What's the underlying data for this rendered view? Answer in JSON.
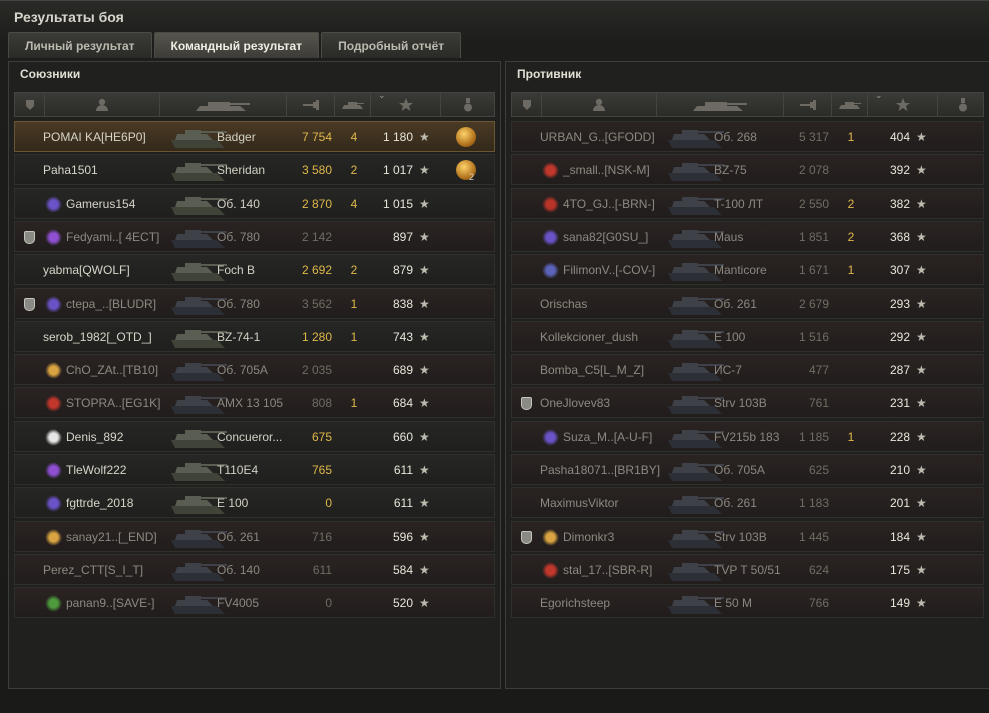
{
  "window_title": "Результаты боя",
  "tabs": [
    "Личный результат",
    "Командный результат",
    "Подробный отчёт"
  ],
  "active_tab": 1,
  "allies_title": "Союзники",
  "enemies_title": "Противник",
  "star_glyph": "★",
  "allies": [
    {
      "player": "POMAI KA[HE6P0]",
      "tank": "Badger",
      "damage": "7 754",
      "kills": "4",
      "xp": "1 180",
      "state": "me",
      "badge": "",
      "medal": "gold"
    },
    {
      "player": "Paha1501",
      "tank": "Sheridan",
      "damage": "3 580",
      "kills": "2",
      "xp": "1 017",
      "state": "alive",
      "badge": "",
      "medal": "gold2",
      "medal_count": "2"
    },
    {
      "player": "Gamerus154",
      "tank": "Об. 140",
      "damage": "2 870",
      "kills": "4",
      "xp": "1 015",
      "state": "alive",
      "badge": "purple",
      "medal": ""
    },
    {
      "player": "Fedyami..[ 4ECT]",
      "tank": "Об. 780",
      "damage": "2 142",
      "kills": "",
      "xp": "897",
      "state": "dead",
      "badge": "violet",
      "premium": true,
      "medal": ""
    },
    {
      "player": "yabma[QWOLF]",
      "tank": "Foch B",
      "damage": "2 692",
      "kills": "2",
      "xp": "879",
      "state": "alive",
      "badge": "",
      "medal": ""
    },
    {
      "player": "ctepa_..[BLUDR]",
      "tank": "Об. 780",
      "damage": "3 562",
      "kills": "1",
      "xp": "838",
      "state": "dead",
      "badge": "purple",
      "premium": true,
      "medal": ""
    },
    {
      "player": "serob_1982[_OTD_]",
      "tank": "BZ-74-1",
      "damage": "1 280",
      "kills": "1",
      "xp": "743",
      "state": "alive",
      "badge": "",
      "medal": ""
    },
    {
      "player": "ChO_ZAt..[TB10]",
      "tank": "Об. 705А",
      "damage": "2 035",
      "kills": "",
      "xp": "689",
      "state": "dead",
      "badge": "gold",
      "medal": ""
    },
    {
      "player": "STOPRA..[EG1K]",
      "tank": "AMX 13 105",
      "damage": "808",
      "kills": "1",
      "xp": "684",
      "state": "dead",
      "badge": "red",
      "medal": ""
    },
    {
      "player": "Denis_892",
      "tank": "Concueror...",
      "damage": "675",
      "kills": "",
      "xp": "660",
      "state": "alive",
      "badge": "white",
      "medal": ""
    },
    {
      "player": "TleWolf222",
      "tank": "T110E4",
      "damage": "765",
      "kills": "",
      "xp": "611",
      "state": "alive",
      "badge": "violet",
      "medal": ""
    },
    {
      "player": "fgttrde_2018",
      "tank": "E 100",
      "damage": "0",
      "kills": "",
      "xp": "611",
      "state": "alive",
      "badge": "purple",
      "medal": ""
    },
    {
      "player": "sanay21..[_END]",
      "tank": "Об. 261",
      "damage": "716",
      "kills": "",
      "xp": "596",
      "state": "dead",
      "badge": "gold",
      "medal": ""
    },
    {
      "player": "Perez_CTT[S_I_T]",
      "tank": "Об. 140",
      "damage": "611",
      "kills": "",
      "xp": "584",
      "state": "dead",
      "badge": "",
      "medal": ""
    },
    {
      "player": "panan9..[SAVE-]",
      "tank": "FV4005",
      "damage": "0",
      "kills": "",
      "xp": "520",
      "state": "dead",
      "badge": "green",
      "medal": ""
    }
  ],
  "enemies": [
    {
      "player": "URBAN_G..[GFODD]",
      "tank": "Об. 268",
      "damage": "5 317",
      "kills": "1",
      "xp": "404",
      "state": "dead",
      "badge": ""
    },
    {
      "player": "_small..[NSK-M]",
      "tank": "BZ-75",
      "damage": "2 078",
      "kills": "",
      "xp": "392",
      "state": "dead",
      "badge": "red"
    },
    {
      "player": "4TO_GJ..[-BRN-]",
      "tank": "T-100 ЛТ",
      "damage": "2 550",
      "kills": "2",
      "xp": "382",
      "state": "dead",
      "badge": "redwhite"
    },
    {
      "player": "sana82[G0SU_]",
      "tank": "Maus",
      "damage": "1 851",
      "kills": "2",
      "xp": "368",
      "state": "dead",
      "badge": "purple"
    },
    {
      "player": "FilimonV..[-COV-]",
      "tank": "Manticore",
      "damage": "1 671",
      "kills": "1",
      "xp": "307",
      "state": "dead",
      "badge": "plane"
    },
    {
      "player": "Orischas",
      "tank": "Об. 261",
      "damage": "2 679",
      "kills": "",
      "xp": "293",
      "state": "dead",
      "badge": ""
    },
    {
      "player": "Kollekcioner_dush",
      "tank": "E 100",
      "damage": "1 516",
      "kills": "",
      "xp": "292",
      "state": "dead",
      "badge": ""
    },
    {
      "player": "Bomba_C5[L_M_Z]",
      "tank": "ИС-7",
      "damage": "477",
      "kills": "",
      "xp": "287",
      "state": "dead",
      "badge": ""
    },
    {
      "player": "OneJlovev83",
      "tank": "Strv 103B",
      "damage": "761",
      "kills": "",
      "xp": "231",
      "state": "dead",
      "badge": "",
      "premium": true
    },
    {
      "player": "Suza_M..[A-U-F]",
      "tank": "FV215b 183",
      "damage": "1 185",
      "kills": "1",
      "xp": "228",
      "state": "dead",
      "badge": "purple"
    },
    {
      "player": "Pasha18071..[BR1BY]",
      "tank": "Об. 705А",
      "damage": "625",
      "kills": "",
      "xp": "210",
      "state": "dead",
      "badge": ""
    },
    {
      "player": "MaximusViktor",
      "tank": "Об. 261",
      "damage": "1 183",
      "kills": "",
      "xp": "201",
      "state": "dead",
      "badge": ""
    },
    {
      "player": "Dimonkr3",
      "tank": "Strv 103B",
      "damage": "1 445",
      "kills": "",
      "xp": "184",
      "state": "dead",
      "badge": "gold",
      "premium": true
    },
    {
      "player": "stal_17..[SBR-R]",
      "tank": "TVP T 50/51",
      "damage": "624",
      "kills": "",
      "xp": "175",
      "state": "dead",
      "badge": "red"
    },
    {
      "player": "Egorichsteep",
      "tank": "E 50 M",
      "damage": "766",
      "kills": "",
      "xp": "149",
      "state": "dead",
      "badge": ""
    }
  ],
  "colors": {
    "gold_text": "#e0b84a",
    "badge_purple": "#6a52c7",
    "badge_violet": "#8e4fd1",
    "badge_gold": "#d9a441",
    "badge_red": "#c2372c",
    "badge_white": "#e6e6e6",
    "badge_green": "#4e9a3c",
    "badge_plane": "#5a63b8",
    "badge_redwhite": "#b93428"
  },
  "icons": {
    "premium": "premium-account-icon",
    "player_col": "player-icon",
    "tank_col": "tank-icon",
    "damage_col": "damage-icon",
    "kills_col": "kills-icon",
    "xp_col": "experience-icon",
    "medal_col": "medal-icon"
  }
}
